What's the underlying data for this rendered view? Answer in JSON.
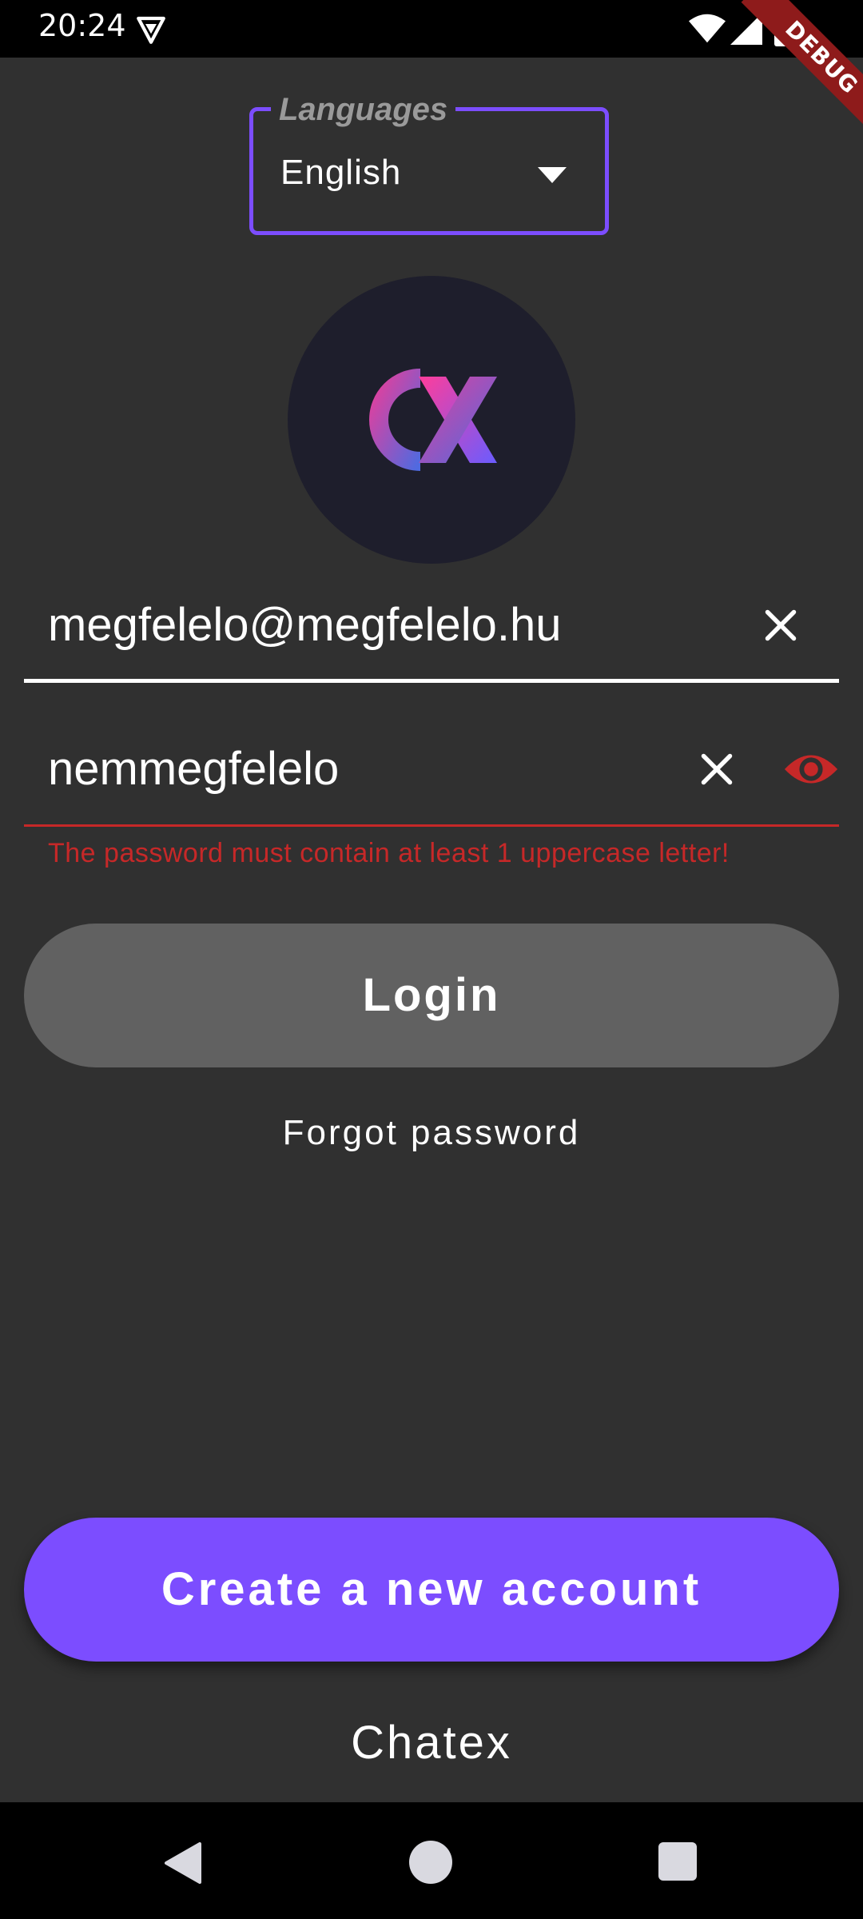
{
  "status_bar": {
    "time": "20:24",
    "icons": [
      "vpn-icon",
      "wifi-icon",
      "signal-icon",
      "battery-icon"
    ]
  },
  "debug_banner": {
    "label": "DEBUG"
  },
  "language_selector": {
    "label": "Languages",
    "selected": "English",
    "icon": "dropdown-arrow-icon"
  },
  "logo": {
    "text": "CX",
    "gradient": [
      "#ff3d9a",
      "#7b5cff"
    ]
  },
  "email_field": {
    "value": "megfelelo@megfelelo.hu",
    "icon": "clear-icon"
  },
  "password_field": {
    "value": "nemmegfelelo",
    "icons": [
      "clear-icon",
      "visibility-icon"
    ],
    "error": "The password must contain at least 1 uppercase letter!"
  },
  "login_button": {
    "label": "Login"
  },
  "forgot_password": {
    "label": "Forgot password"
  },
  "create_account_button": {
    "label": "Create a new account"
  },
  "app_name": "Chatex",
  "nav_bar": {
    "icons": [
      "back-icon",
      "home-icon",
      "recents-icon"
    ]
  },
  "colors": {
    "background": "#303030",
    "accent": "#7c4dff",
    "error": "#c62828",
    "button_disabled": "#616161"
  }
}
